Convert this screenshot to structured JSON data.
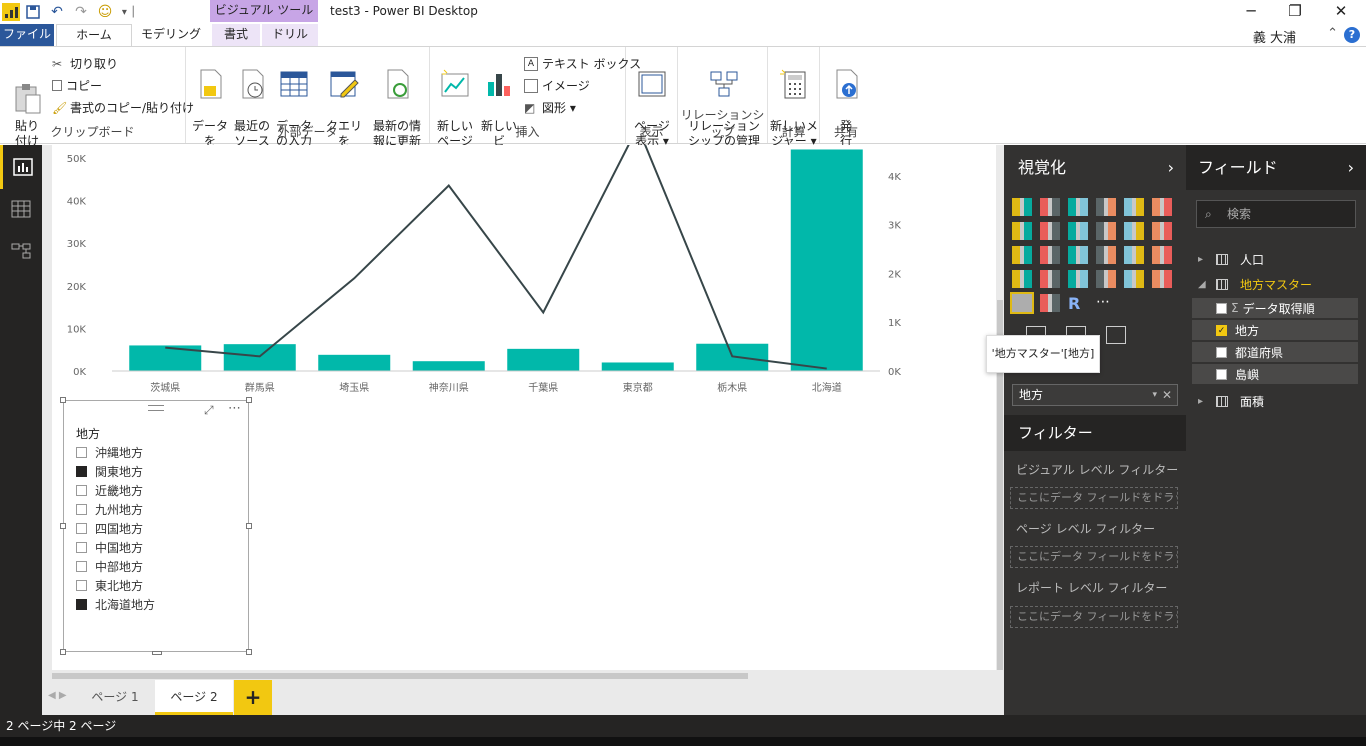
{
  "window": {
    "title": "test3 - Power BI Desktop",
    "context_tab_header": "ビジュアル ツール",
    "user_name": "義 大浦"
  },
  "ribbon_tabs": [
    "ファイル",
    "ホーム",
    "モデリング",
    "書式",
    "ドリル"
  ],
  "ribbon": {
    "clipboard": {
      "paste": "貼り\n付け",
      "cut": "切り取り",
      "copy": "コピー",
      "format_painter": "書式のコピー/貼り付け",
      "label": "クリップボード"
    },
    "external_data": {
      "get_data": "データを\n取得 ▾",
      "recent_sources": "最近の\nソース ▾",
      "enter_data": "データ\nの入力",
      "edit_queries": "クエリを\n編集 ▾",
      "refresh": "最新の情\n報に更新",
      "label": "外部データ"
    },
    "insert": {
      "new_page": "新しい\nページ ▾",
      "new_visual": "新しいビ\nジュアル",
      "text_box": "テキスト ボックス",
      "image": "イメージ",
      "shapes": "図形 ▾",
      "label": "挿入"
    },
    "view": {
      "page_view": "ページ\n表示 ▾",
      "label": "表示"
    },
    "relationships": {
      "manage": "リレーション\nシップの管理",
      "label": "リレーションシップ"
    },
    "calculations": {
      "new_measure": "新しいメ\nジャー ▾",
      "label": "計算"
    },
    "share": {
      "publish": "発\n行",
      "label": "共有"
    }
  },
  "chart_data": {
    "type": "bar",
    "categories": [
      "茨城県",
      "群馬県",
      "埼玉県",
      "神奈川県",
      "千葉県",
      "東京都",
      "栃木県",
      "北海道"
    ],
    "series": [
      {
        "type": "bar",
        "axis": "left",
        "values": [
          6000,
          6300,
          3800,
          2300,
          5200,
          2000,
          6400,
          52000
        ]
      },
      {
        "type": "line",
        "axis": "right",
        "values": [
          480,
          300,
          1900,
          3800,
          1200,
          5000,
          300,
          50
        ]
      }
    ],
    "y_left": {
      "ticks": [
        "0K",
        "10K",
        "20K",
        "30K",
        "40K",
        "50K"
      ],
      "range": [
        0,
        50000
      ]
    },
    "y_right": {
      "ticks": [
        "0K",
        "1K",
        "2K",
        "3K",
        "4K"
      ],
      "range": [
        0,
        4000
      ]
    },
    "colors": {
      "bar": "#01b8aa",
      "line": "#374649"
    }
  },
  "slicer": {
    "title": "地方",
    "items": [
      {
        "label": "沖縄地方",
        "checked": false
      },
      {
        "label": "関東地方",
        "checked": true
      },
      {
        "label": "近畿地方",
        "checked": false
      },
      {
        "label": "九州地方",
        "checked": false
      },
      {
        "label": "四国地方",
        "checked": false
      },
      {
        "label": "中国地方",
        "checked": false
      },
      {
        "label": "中部地方",
        "checked": false
      },
      {
        "label": "東北地方",
        "checked": false
      },
      {
        "label": "北海道地方",
        "checked": true
      }
    ]
  },
  "pages": {
    "tab1": "ページ 1",
    "tab2": "ページ 2",
    "add": "+"
  },
  "status": "2 ページ中 2 ページ",
  "visualizations": {
    "header": "視覚化",
    "tooltip": "'地方マスター'[地方]",
    "field_well_value": "地方",
    "filters_header": "フィルター",
    "visual_level": "ビジュアル レベル フィルター",
    "page_level": "ページ レベル フィルター",
    "report_level": "レポート レベル フィルター",
    "drop_hint": "ここにデータ フィールドをドラッグ..."
  },
  "fields": {
    "header": "フィールド",
    "search_placeholder": "検索",
    "tables": [
      {
        "name": "人口"
      },
      {
        "name": "地方マスター",
        "fields": [
          {
            "name": "データ取得順",
            "checked": false,
            "sigma": true
          },
          {
            "name": "地方",
            "checked": true
          },
          {
            "name": "都道府県",
            "checked": false
          },
          {
            "name": "島嶼",
            "checked": false
          }
        ]
      },
      {
        "name": "面積"
      }
    ]
  },
  "colors": {
    "accent": "#f2c811",
    "pane_dark": "#333231"
  }
}
